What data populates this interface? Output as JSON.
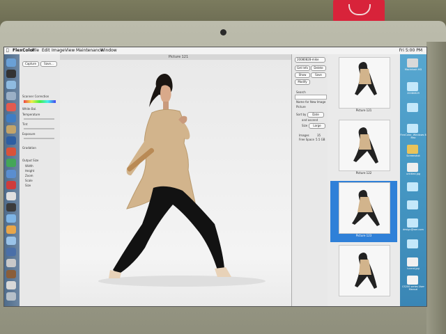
{
  "app": {
    "name": "FlexColor",
    "menus": [
      "File",
      "Edit",
      "Image",
      "View",
      "Maintenance",
      "Window"
    ],
    "clock": "Fri 5:00 PM"
  },
  "left_panel": {
    "buttons": [
      "Capture",
      "Save..."
    ],
    "labels": [
      "Scanner Correction",
      "White Bal.",
      "Temperature",
      "Tint",
      "Exposure",
      "Gradation",
      "Output Size",
      "Width",
      "Height",
      "Zoom",
      "Scale",
      "Size"
    ]
  },
  "photo_window": {
    "title": "Picture 121"
  },
  "browser": {
    "folder": "20080828-mike",
    "buttons": [
      "Get Info",
      "Delete",
      "Show",
      "Save",
      "Modify"
    ],
    "labels": [
      "Search",
      "Name for New Image",
      "Picture",
      "Sort by",
      "Size",
      "Images",
      "Free Space"
    ],
    "sort_value": "Date",
    "size_value": "Large",
    "checkbox": "and ascend",
    "images_count": "35",
    "free_space": "5.5 GB",
    "thumbnails": [
      {
        "label": "Picture 121"
      },
      {
        "label": "Picture 122"
      },
      {
        "label": "Picture 123"
      },
      {
        "label": ""
      }
    ]
  },
  "desktop_icons": [
    "Macintosh HD",
    "20080829",
    "",
    "FlexColor, Windows 8 Mac",
    "Screenshot",
    "untitled.jpg",
    "",
    "",
    "design@wer.com",
    "",
    "",
    "lucent.jpg",
    "CS200 series User Manual"
  ],
  "colors": {
    "selection": "#2f80d8",
    "desktop": "#4597c3",
    "bag": "#d8233a"
  }
}
